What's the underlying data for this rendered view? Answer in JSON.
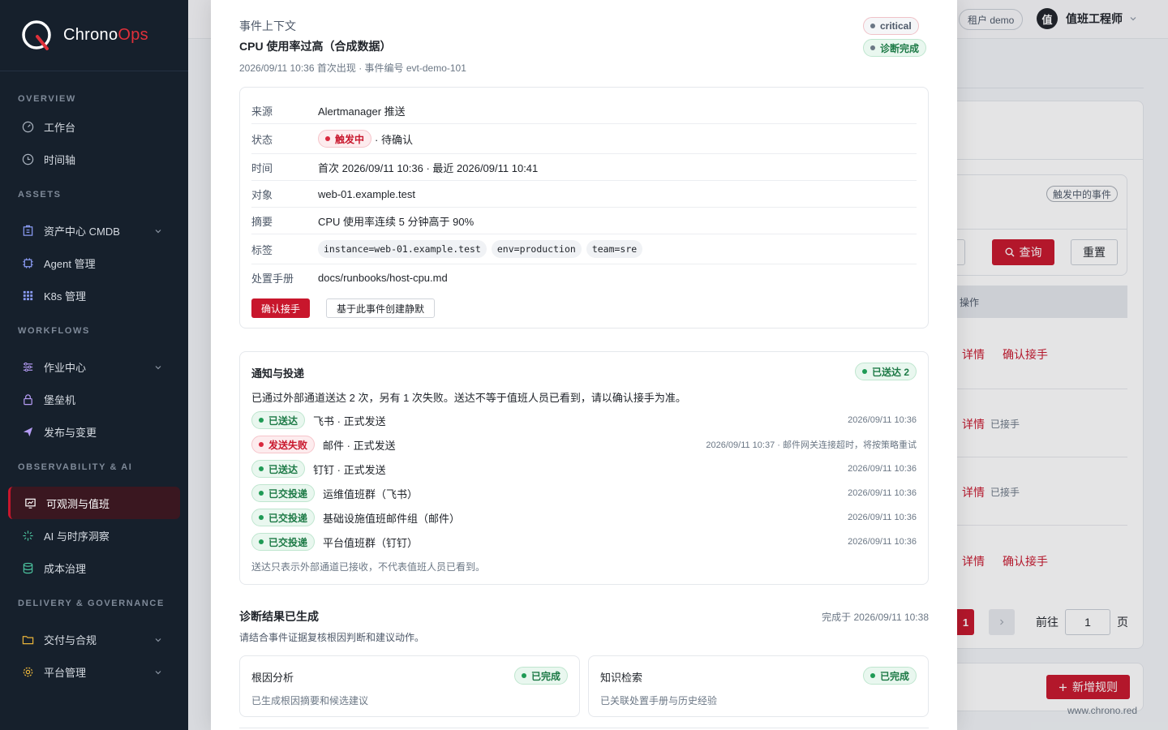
{
  "brand": {
    "name_prefix": "Chrono",
    "name_suffix": "Ops",
    "accent": "#c8162c"
  },
  "sidebar": {
    "sections": [
      {
        "label": "OVERVIEW"
      },
      {
        "label": "ASSETS"
      },
      {
        "label": "WORKFLOWS"
      },
      {
        "label": "OBSERVABILITY & AI"
      },
      {
        "label": "DELIVERY & GOVERNANCE"
      }
    ],
    "items": [
      {
        "label": "工作台",
        "icon": "dashboard-icon"
      },
      {
        "label": "时间轴",
        "icon": "clock-icon"
      },
      {
        "label": "资产中心 CMDB",
        "icon": "building-icon"
      },
      {
        "label": "Agent 管理",
        "icon": "chip-icon"
      },
      {
        "label": "K8s 管理",
        "icon": "grid-icon"
      },
      {
        "label": "作业中心",
        "icon": "sliders-icon"
      },
      {
        "label": "堡垒机",
        "icon": "lock-icon"
      },
      {
        "label": "发布与变更",
        "icon": "send-icon"
      },
      {
        "label": "可观测与值班",
        "icon": "monitor-icon"
      },
      {
        "label": "AI 与时序洞察",
        "icon": "sparkle-icon"
      },
      {
        "label": "成本治理",
        "icon": "database-icon"
      },
      {
        "label": "交付与合规",
        "icon": "folder-icon"
      },
      {
        "label": "平台管理",
        "icon": "gear-icon"
      }
    ]
  },
  "topbar": {
    "tenant": "租户 demo",
    "avatar_char": "值",
    "user": "值班工程师"
  },
  "background": {
    "firing_tag": "触发中的事件",
    "query": "查询",
    "reset": "重置",
    "col_action": "操作",
    "detail": "详情",
    "ack": "确认接手",
    "acked": "已接手",
    "page_current": "1",
    "goto_label": "前往",
    "goto_value": "1",
    "page_suffix": "页",
    "new_rule": "新增规则",
    "footer_url": "www.chrono.red"
  },
  "event": {
    "context_label": "事件上下文",
    "title": "CPU 使用率过高（合成数据）",
    "meta": "2026/09/11 10:36 首次出现 · 事件编号 evt-demo-101",
    "severity": "critical",
    "diag_status": "诊断完成",
    "rows": {
      "source_key": "来源",
      "source_val": "Alertmanager 推送",
      "status_key": "状态",
      "status_tag": "触发中",
      "status_extra": "· 待确认",
      "time_key": "时间",
      "time_val": "首次 2026/09/11 10:36 · 最近 2026/09/11 10:41",
      "target_key": "对象",
      "target_val": "web-01.example.test",
      "summary_key": "摘要",
      "summary_val": "CPU 使用率连续 5 分钟高于 90%",
      "labels_key": "标签",
      "labels": [
        "instance=web-01.example.test",
        "env=production",
        "team=sre"
      ],
      "runbook_key": "处置手册",
      "runbook_val": "docs/runbooks/host-cpu.md"
    },
    "ack_button": "确认接手",
    "silence_button": "基于此事件创建静默"
  },
  "notice": {
    "title": "通知与投递",
    "badge": "已送达 2",
    "desc": "已通过外部通道送达 2 次，另有 1 次失败。送达不等于值班人员已看到，请以确认接手为准。",
    "rows": [
      {
        "status": "已送达",
        "text": "飞书 · 正式发送",
        "time": "2026/09/11 10:36"
      },
      {
        "status": "发送失败",
        "text": "邮件 · 正式发送",
        "time": "2026/09/11 10:37 · 邮件网关连接超时，将按策略重试"
      },
      {
        "status": "已送达",
        "text": "钉钉 · 正式发送",
        "time": "2026/09/11 10:36"
      },
      {
        "status": "已交投递",
        "text": "运维值班群（飞书）",
        "time": "2026/09/11 10:36"
      },
      {
        "status": "已交投递",
        "text": "基础设施值班邮件组（邮件）",
        "time": "2026/09/11 10:36"
      },
      {
        "status": "已交投递",
        "text": "平台值班群（钉钉）",
        "time": "2026/09/11 10:36"
      }
    ],
    "footnote": "送达只表示外部通道已接收，不代表值班人员已看到。"
  },
  "diagnosis": {
    "title": "诊断结果已生成",
    "time": "完成于 2026/09/11 10:38",
    "desc": "请结合事件证据复核根因判断和建议动作。",
    "cards": [
      {
        "title": "根因分析",
        "tag": "已完成",
        "desc": "已生成根因摘要和候选建议"
      },
      {
        "title": "知识检索",
        "tag": "已完成",
        "desc": "已关联处置手册与历史经验"
      }
    ]
  }
}
